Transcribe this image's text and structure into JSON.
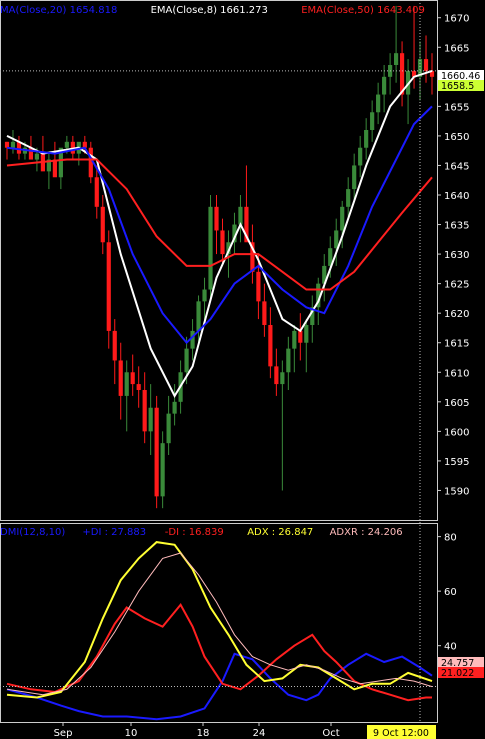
{
  "chart_data": [
    {
      "type": "candlestick",
      "panel": "price",
      "legend": [
        {
          "label": "MA(Close,20)",
          "value": "1654.818",
          "color": "#1a1aff"
        },
        {
          "label": "EMA(Close,8)",
          "value": "1661.273",
          "color": "#ffffff"
        },
        {
          "label": "EMA(Close,50)",
          "value": "1643.409",
          "color": "#ff2020"
        }
      ],
      "y_ticks": [
        "1670",
        "1665",
        "1660",
        "1655",
        "1650",
        "1645",
        "1640",
        "1635",
        "1630",
        "1625",
        "1620",
        "1615",
        "1610",
        "1605",
        "1600",
        "1595",
        "1590"
      ],
      "ylim": [
        1585,
        1673
      ],
      "x_ticks": [
        "Sep",
        "10",
        "18",
        "24",
        "Oct"
      ],
      "price_labels": [
        {
          "value": "1660.46",
          "bg": "#ffffff",
          "fg": "#000000"
        },
        {
          "value": "1658.5",
          "bg": "#ccff33",
          "fg": "#000000"
        }
      ],
      "candles": [
        [
          1649,
          1649,
          1646,
          1648
        ],
        [
          1648,
          1651,
          1647,
          1649
        ],
        [
          1649,
          1650,
          1646,
          1647
        ],
        [
          1647,
          1649,
          1646,
          1648
        ],
        [
          1648,
          1650,
          1647,
          1646
        ],
        [
          1646,
          1648,
          1644,
          1647
        ],
        [
          1647,
          1650,
          1645,
          1644
        ],
        [
          1644,
          1647,
          1641,
          1646
        ],
        [
          1646,
          1649,
          1645,
          1643
        ],
        [
          1643,
          1646,
          1641,
          1648
        ],
        [
          1648,
          1650,
          1647,
          1649
        ],
        [
          1649,
          1650,
          1646,
          1647
        ],
        [
          1647,
          1648,
          1645,
          1649
        ],
        [
          1649,
          1650,
          1647,
          1648
        ],
        [
          1648,
          1649,
          1642,
          1643
        ],
        [
          1643,
          1645,
          1636,
          1638
        ],
        [
          1638,
          1640,
          1630,
          1632
        ],
        [
          1632,
          1634,
          1614,
          1617
        ],
        [
          1617,
          1619,
          1608,
          1612
        ],
        [
          1612,
          1615,
          1602,
          1606
        ],
        [
          1606,
          1612,
          1600,
          1610
        ],
        [
          1610,
          1613,
          1606,
          1608
        ],
        [
          1608,
          1611,
          1604,
          1607
        ],
        [
          1607,
          1610,
          1598,
          1600
        ],
        [
          1600,
          1608,
          1596,
          1604
        ],
        [
          1604,
          1606,
          1587,
          1589
        ],
        [
          1589,
          1600,
          1587,
          1598
        ],
        [
          1598,
          1606,
          1596,
          1603
        ],
        [
          1603,
          1608,
          1601,
          1605
        ],
        [
          1605,
          1612,
          1603,
          1610
        ],
        [
          1610,
          1616,
          1608,
          1614
        ],
        [
          1614,
          1619,
          1612,
          1617
        ],
        [
          1617,
          1623,
          1615,
          1622
        ],
        [
          1622,
          1626,
          1618,
          1624
        ],
        [
          1624,
          1640,
          1622,
          1638
        ],
        [
          1638,
          1640,
          1630,
          1634
        ],
        [
          1634,
          1636,
          1628,
          1630
        ],
        [
          1630,
          1634,
          1626,
          1632
        ],
        [
          1632,
          1637,
          1630,
          1635
        ],
        [
          1635,
          1640,
          1632,
          1638
        ],
        [
          1638,
          1645,
          1633,
          1632
        ],
        [
          1632,
          1635,
          1625,
          1627
        ],
        [
          1627,
          1630,
          1619,
          1622
        ],
        [
          1622,
          1625,
          1616,
          1618
        ],
        [
          1618,
          1621,
          1609,
          1611
        ],
        [
          1611,
          1614,
          1606,
          1608
        ],
        [
          1608,
          1612,
          1590,
          1610
        ],
        [
          1610,
          1616,
          1607,
          1614
        ],
        [
          1614,
          1618,
          1610,
          1617
        ],
        [
          1617,
          1620,
          1612,
          1615
        ],
        [
          1615,
          1619,
          1610,
          1618
        ],
        [
          1618,
          1623,
          1615,
          1621
        ],
        [
          1621,
          1626,
          1618,
          1625
        ],
        [
          1625,
          1630,
          1622,
          1628
        ],
        [
          1628,
          1633,
          1626,
          1631
        ],
        [
          1631,
          1636,
          1628,
          1634
        ],
        [
          1634,
          1639,
          1631,
          1638
        ],
        [
          1638,
          1643,
          1636,
          1641
        ],
        [
          1641,
          1647,
          1639,
          1645
        ],
        [
          1645,
          1650,
          1643,
          1648
        ],
        [
          1648,
          1653,
          1646,
          1651
        ],
        [
          1651,
          1656,
          1649,
          1654
        ],
        [
          1654,
          1659,
          1652,
          1657
        ],
        [
          1657,
          1662,
          1654,
          1660
        ],
        [
          1660,
          1664,
          1657,
          1662
        ],
        [
          1662,
          1672,
          1659,
          1664
        ],
        [
          1664,
          1666,
          1655,
          1657
        ],
        [
          1657,
          1663,
          1652,
          1661
        ],
        [
          1661,
          1672,
          1658,
          1660
        ],
        [
          1660,
          1666,
          1656,
          1663
        ],
        [
          1663,
          1667,
          1659,
          1661
        ],
        [
          1661,
          1664,
          1657,
          1660
        ]
      ],
      "series": [
        {
          "name": "EMA(Close,8)",
          "color": "#ffffff",
          "points": [
            [
              0,
              1650
            ],
            [
              6,
              1647
            ],
            [
              12,
              1648
            ],
            [
              15,
              1646
            ],
            [
              19,
              1630
            ],
            [
              24,
              1614
            ],
            [
              28,
              1606
            ],
            [
              31,
              1611
            ],
            [
              35,
              1626
            ],
            [
              39,
              1635
            ],
            [
              42,
              1629
            ],
            [
              46,
              1619
            ],
            [
              49,
              1617
            ],
            [
              52,
              1622
            ],
            [
              56,
              1633
            ],
            [
              60,
              1645
            ],
            [
              64,
              1655
            ],
            [
              68,
              1660
            ],
            [
              71,
              1661
            ]
          ]
        },
        {
          "name": "MA(Close,20)",
          "color": "#1a1aff",
          "points": [
            [
              0,
              1648
            ],
            [
              8,
              1647
            ],
            [
              13,
              1648
            ],
            [
              17,
              1641
            ],
            [
              21,
              1630
            ],
            [
              26,
              1620
            ],
            [
              30,
              1615
            ],
            [
              34,
              1619
            ],
            [
              38,
              1625
            ],
            [
              42,
              1628
            ],
            [
              46,
              1624
            ],
            [
              50,
              1621
            ],
            [
              53,
              1620
            ],
            [
              57,
              1628
            ],
            [
              61,
              1638
            ],
            [
              65,
              1646
            ],
            [
              68,
              1652
            ],
            [
              71,
              1655
            ]
          ]
        },
        {
          "name": "EMA(Close,50)",
          "color": "#ff2020",
          "points": [
            [
              0,
              1645
            ],
            [
              10,
              1646
            ],
            [
              15,
              1646
            ],
            [
              20,
              1641
            ],
            [
              25,
              1633
            ],
            [
              30,
              1628
            ],
            [
              34,
              1628
            ],
            [
              38,
              1630
            ],
            [
              42,
              1630
            ],
            [
              46,
              1627
            ],
            [
              50,
              1624
            ],
            [
              54,
              1624
            ],
            [
              58,
              1627
            ],
            [
              62,
              1632
            ],
            [
              66,
              1637
            ],
            [
              71,
              1643
            ]
          ]
        }
      ]
    },
    {
      "type": "line",
      "panel": "dmi",
      "legend": [
        {
          "label": "DMI(12,8,10)",
          "value": "",
          "color": "#1a1aff"
        },
        {
          "label": "+DI :",
          "value": "27.883",
          "color": "#1a1aff"
        },
        {
          "label": "-DI :",
          "value": "16.839",
          "color": "#ff2020"
        },
        {
          "label": "ADX :",
          "value": "26.847",
          "color": "#ffff33"
        },
        {
          "label": "ADXR :",
          "value": "24.206",
          "color": "#ffbbbb"
        }
      ],
      "y_ticks": [
        "80",
        "60",
        "40"
      ],
      "ylim": [
        12,
        85
      ],
      "x_ticks": [
        "Sep",
        "10",
        "18",
        "24",
        "Oct"
      ],
      "date_label": "9 Oct 12:00",
      "value_labels": [
        {
          "value": "24.757",
          "bg": "#ffbbbb",
          "fg": "#000000"
        },
        {
          "value": "21.022",
          "bg": "#ff2020",
          "fg": "#000000"
        }
      ],
      "series": [
        {
          "name": "+DI",
          "color": "#1a1aff",
          "points": [
            [
              0,
              24
            ],
            [
              5,
              21
            ],
            [
              9,
              18
            ],
            [
              12,
              16
            ],
            [
              16,
              14
            ],
            [
              20,
              14
            ],
            [
              25,
              13
            ],
            [
              29,
              14
            ],
            [
              33,
              17
            ],
            [
              36,
              27
            ],
            [
              38,
              37
            ],
            [
              41,
              35
            ],
            [
              44,
              28
            ],
            [
              47,
              22
            ],
            [
              50,
              20
            ],
            [
              52,
              22
            ],
            [
              54,
              28
            ],
            [
              57,
              33
            ],
            [
              60,
              37
            ],
            [
              63,
              34
            ],
            [
              66,
              36
            ],
            [
              69,
              32
            ],
            [
              71,
              29
            ]
          ]
        },
        {
          "name": "-DI",
          "color": "#ff2020",
          "points": [
            [
              0,
              26
            ],
            [
              4,
              24
            ],
            [
              8,
              23
            ],
            [
              12,
              27
            ],
            [
              15,
              36
            ],
            [
              18,
              48
            ],
            [
              20,
              54
            ],
            [
              23,
              50
            ],
            [
              26,
              47
            ],
            [
              29,
              55
            ],
            [
              31,
              47
            ],
            [
              33,
              36
            ],
            [
              36,
              26
            ],
            [
              39,
              24
            ],
            [
              42,
              29
            ],
            [
              45,
              35
            ],
            [
              48,
              40
            ],
            [
              51,
              44
            ],
            [
              53,
              38
            ],
            [
              55,
              34
            ],
            [
              58,
              27
            ],
            [
              61,
              24
            ],
            [
              64,
              22
            ],
            [
              67,
              20
            ],
            [
              70,
              21
            ],
            [
              71,
              21
            ]
          ]
        },
        {
          "name": "ADX",
          "color": "#ffff33",
          "points": [
            [
              0,
              22
            ],
            [
              5,
              21
            ],
            [
              9,
              23
            ],
            [
              13,
              34
            ],
            [
              16,
              50
            ],
            [
              19,
              64
            ],
            [
              22,
              72
            ],
            [
              25,
              78
            ],
            [
              28,
              77
            ],
            [
              31,
              68
            ],
            [
              34,
              54
            ],
            [
              37,
              44
            ],
            [
              40,
              33
            ],
            [
              43,
              27
            ],
            [
              46,
              28
            ],
            [
              49,
              33
            ],
            [
              52,
              32
            ],
            [
              55,
              28
            ],
            [
              58,
              24
            ],
            [
              61,
              26
            ],
            [
              64,
              26
            ],
            [
              67,
              30
            ],
            [
              71,
              27
            ]
          ]
        },
        {
          "name": "ADXR",
          "color": "#ffbbbb",
          "points": [
            [
              0,
              24
            ],
            [
              6,
              22
            ],
            [
              10,
              24
            ],
            [
              14,
              32
            ],
            [
              18,
              45
            ],
            [
              22,
              60
            ],
            [
              26,
              72
            ],
            [
              29,
              74
            ],
            [
              32,
              66
            ],
            [
              35,
              56
            ],
            [
              38,
              44
            ],
            [
              41,
              36
            ],
            [
              44,
              33
            ],
            [
              47,
              31
            ],
            [
              50,
              33
            ],
            [
              53,
              31
            ],
            [
              56,
              28
            ],
            [
              59,
              26
            ],
            [
              62,
              27
            ],
            [
              65,
              28
            ],
            [
              68,
              27
            ],
            [
              71,
              25
            ]
          ]
        }
      ]
    }
  ]
}
